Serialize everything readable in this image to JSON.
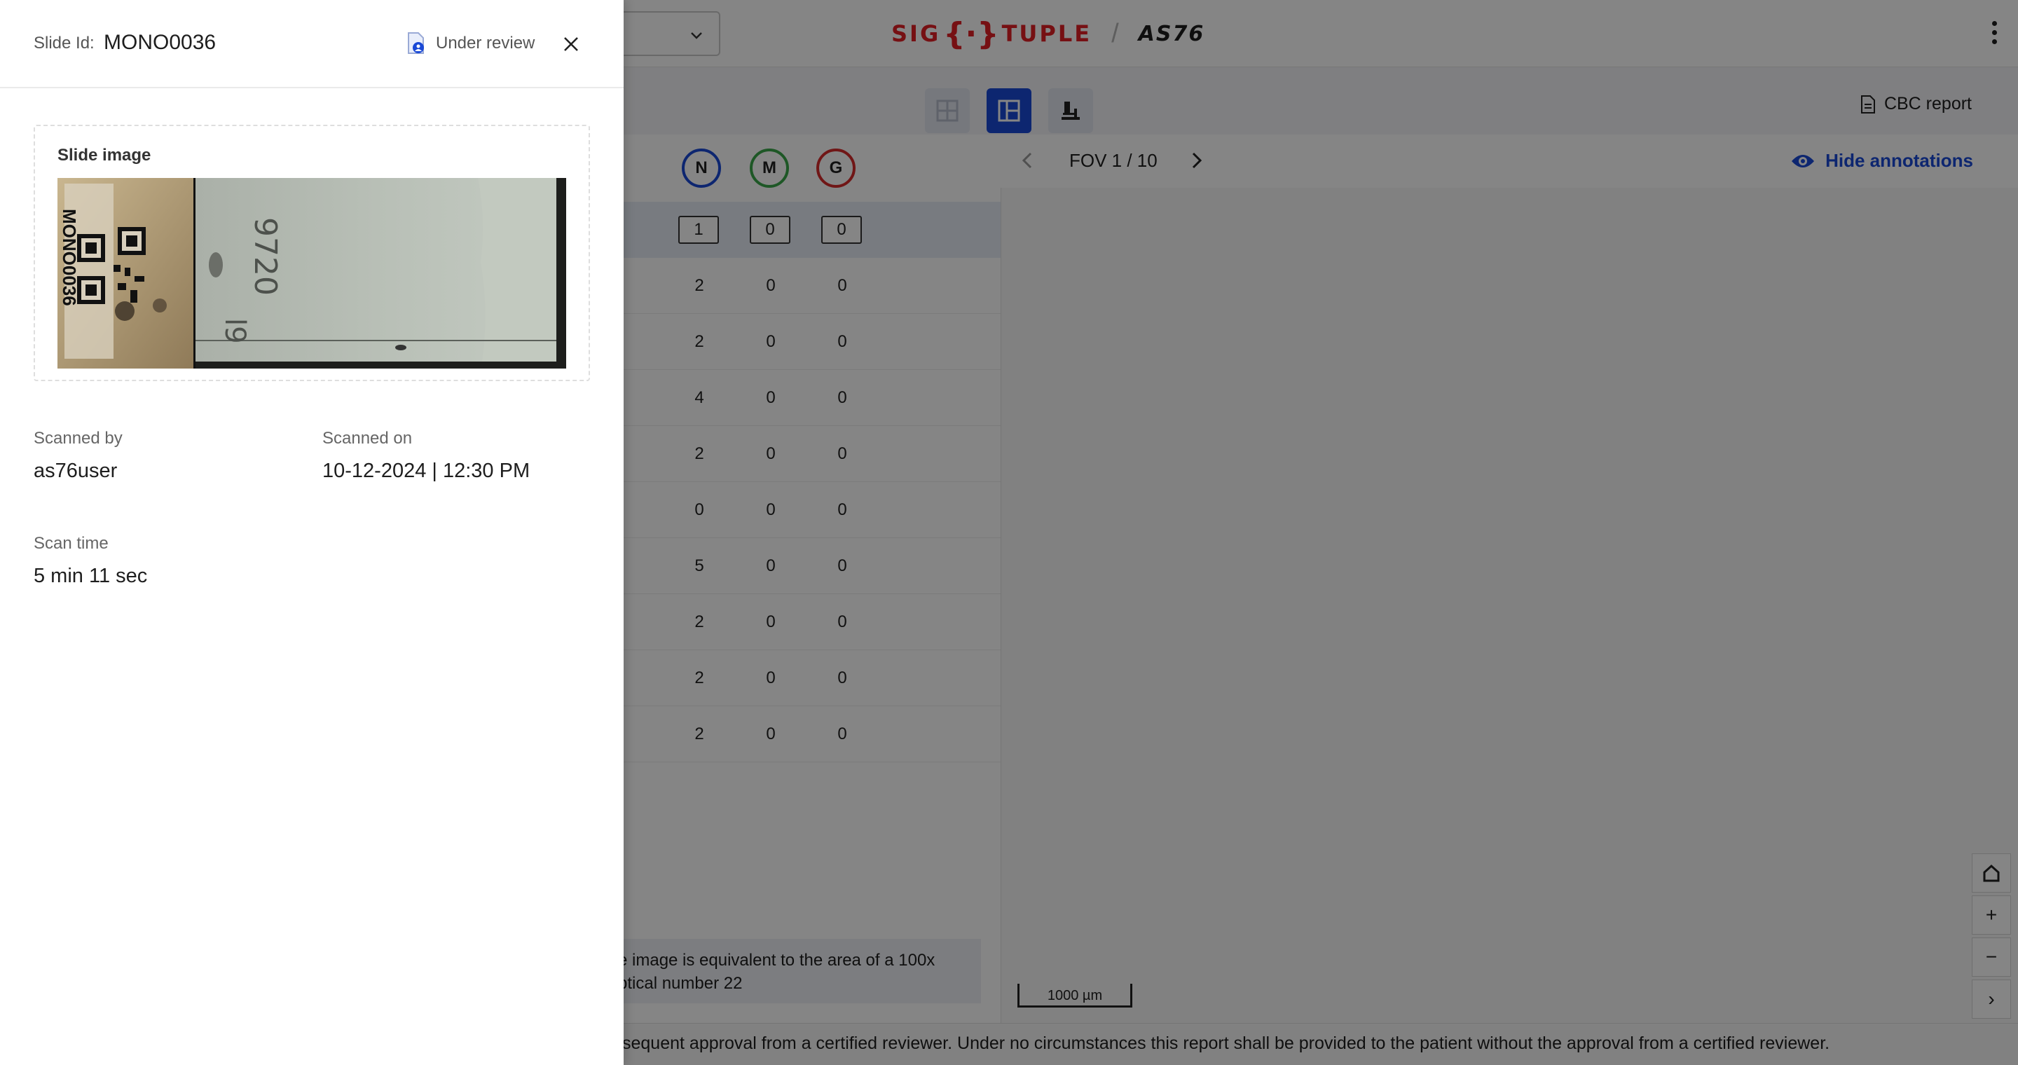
{
  "app": {
    "brand_name": "SIG{}TUPLE",
    "brand_left": "SIG",
    "brand_right": "TUPLE",
    "brand_sep": "/",
    "model": "AS76",
    "cbc_report_label": "CBC report",
    "fov_label": "FOV 1 / 10",
    "hide_annotations_label": "Hide annotations",
    "scale_label": "1000 µm",
    "zoom_plus": "+",
    "zoom_minus": "−",
    "zoom_next": "›",
    "note_line1": "e image is equivalent to the area of a 100x",
    "note_line2": "ptical number 22",
    "footer_text": "sequent approval from a certified reviewer. Under no circumstances this report shall be provided to the patient without the approval from a certified reviewer."
  },
  "table": {
    "columns": [
      {
        "key": "N",
        "label": "N",
        "color": "#1a49d6"
      },
      {
        "key": "M",
        "label": "M",
        "color": "#3aa84a"
      },
      {
        "key": "G",
        "label": "G",
        "color": "#d62b2b"
      }
    ],
    "selected": {
      "n": "1",
      "m": "0",
      "g": "0"
    },
    "rows": [
      {
        "n": "2",
        "m": "0",
        "g": "0"
      },
      {
        "n": "2",
        "m": "0",
        "g": "0"
      },
      {
        "n": "4",
        "m": "0",
        "g": "0"
      },
      {
        "n": "2",
        "m": "0",
        "g": "0"
      },
      {
        "n": "0",
        "m": "0",
        "g": "0"
      },
      {
        "n": "5",
        "m": "0",
        "g": "0"
      },
      {
        "n": "2",
        "m": "0",
        "g": "0"
      },
      {
        "n": "2",
        "m": "0",
        "g": "0"
      },
      {
        "n": "2",
        "m": "0",
        "g": "0"
      }
    ]
  },
  "drawer": {
    "slide_id_label": "Slide Id:",
    "slide_id": "MONO0036",
    "status": "Under review",
    "slide_image_title": "Slide image",
    "slide_label_text": "MONO0036",
    "slide_handwriting": "9720",
    "scanned_by_label": "Scanned by",
    "scanned_by": "as76user",
    "scanned_on_label": "Scanned on",
    "scanned_on": "10-12-2024 | 12:30 PM",
    "scan_time_label": "Scan time",
    "scan_time": "5 min 11 sec"
  },
  "colors": {
    "accent": "#1a49d6",
    "brand_red": "#e21f26"
  },
  "icons": [
    "chevron-down-icon",
    "kebab-menu-icon",
    "grid-view-icon",
    "split-view-icon",
    "microscope-icon",
    "document-icon",
    "chevron-left-icon",
    "chevron-right-icon",
    "eye-icon",
    "home-icon",
    "plus-icon",
    "minus-icon",
    "review-status-icon",
    "close-icon"
  ]
}
